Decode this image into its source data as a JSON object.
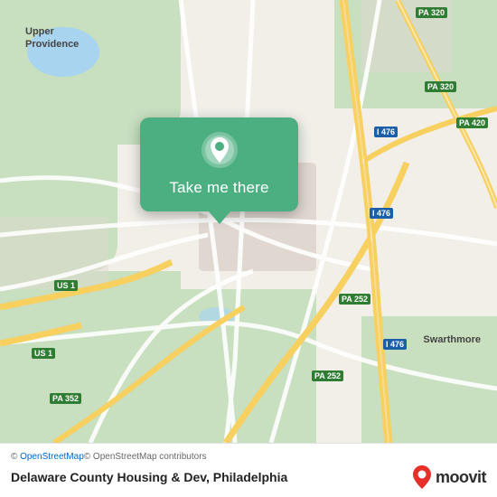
{
  "map": {
    "attribution_text": "© OpenStreetMap contributors",
    "attribution_link_text": "OpenStreetMap",
    "attribution_link": "#",
    "contributors_link": "#"
  },
  "popup": {
    "button_label": "Take me there",
    "pin_icon": "location-pin"
  },
  "footer": {
    "location_name": "Delaware County Housing & Dev, Philadelphia"
  },
  "moovit": {
    "logo_text": "moovit"
  },
  "highway_labels": [
    {
      "id": "pa320-top-right",
      "text": "PA 320"
    },
    {
      "id": "pa320-mid-right",
      "text": "PA 320"
    },
    {
      "id": "pa420",
      "text": "PA 420"
    },
    {
      "id": "i476-right",
      "text": "I 476"
    },
    {
      "id": "i476-mid",
      "text": "I 476"
    },
    {
      "id": "i476-bottom",
      "text": "I 476"
    },
    {
      "id": "us1-left",
      "text": "US 1"
    },
    {
      "id": "us1-left2",
      "text": "US 1"
    },
    {
      "id": "pa252-right",
      "text": "PA 252"
    },
    {
      "id": "pa252-bottom",
      "text": "PA 252"
    },
    {
      "id": "pa352",
      "text": "PA 352"
    },
    {
      "id": "upper-providence",
      "text": "Upper\nProvidence"
    },
    {
      "id": "swarthmore",
      "text": "Swarthmore"
    }
  ]
}
